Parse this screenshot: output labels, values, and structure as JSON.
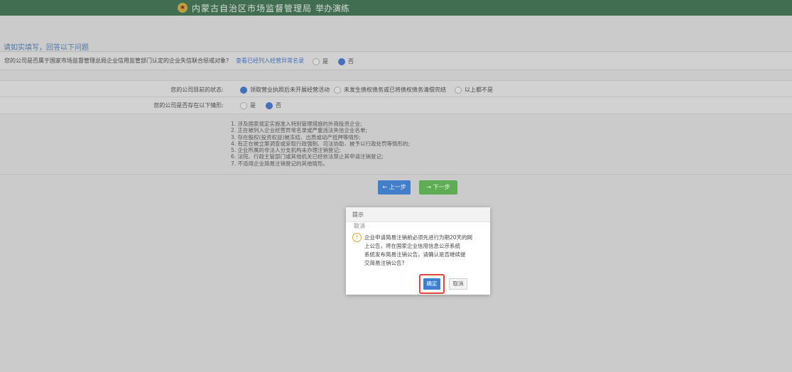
{
  "header": {
    "emblem_icon": "national-emblem-icon",
    "title": "内蒙古自治区市场监督管理局",
    "subtitle": "举办演练"
  },
  "section": {
    "title": "请如实填写，回答以下问题"
  },
  "question1": {
    "text": "您的公司是否属于国家市场监督管理总局企业信用监管部门认定的企业失信联合惩戒对象?",
    "link": "查看已经列入经营异常名录",
    "options": [
      "是",
      "否"
    ],
    "selected": "否"
  },
  "question2": {
    "label": "您的公司目前的状态:",
    "options": [
      "领取营业执照后未开展经营活动",
      "未发生债权债务或已将债权债务清偿完结",
      "以上都不是"
    ],
    "selected": "领取营业执照后未开展经营活动"
  },
  "question3": {
    "label": "您的公司是否存在以下情形:",
    "options": [
      "是",
      "否"
    ],
    "selected": "否"
  },
  "notes": [
    "1. 涉及国家规定实施准入特别管理措施的外商投资企业;",
    "2. 正在被列入企业经营异常名录或严重违法失信企业名单;",
    "3. 存在股权(投资权益)被冻结、出质或动产抵押等情形;",
    "4. 有正在被立案调查或采取行政强制、司法协助、被予以行政处罚等情形的;",
    "5. 企业所属的非法人分支机构未办理注销登记;",
    "6. 法院、行政主管部门或其他机关已经依法禁止其申请注销登记;",
    "7. 不适用企业简易注销登记的其他情形。"
  ],
  "buttons": {
    "back": "← 上一步",
    "next": "→ 下一步"
  },
  "dialog": {
    "title": "提示",
    "close": "取消",
    "warn_icon": "warning-icon",
    "message_lines": [
      "企业申请简易注销前必须先进行为期20天的网",
      "上公告，将在国家企业信用信息公示系统",
      "系统发布简易注销公告，请确认是否继续提",
      "交简易注销公告?"
    ],
    "ok": "确定",
    "cancel": "取消"
  },
  "colors": {
    "header_bg": "#3a6b4b",
    "accent_blue": "#3b7fd4",
    "accent_green": "#5ab44f",
    "highlight_red": "#e8413a"
  }
}
